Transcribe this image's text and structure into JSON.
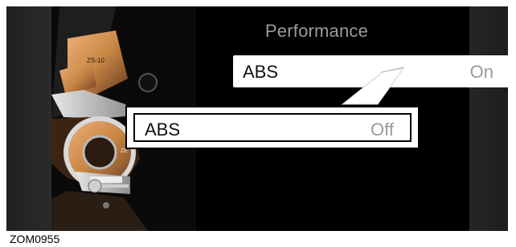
{
  "screen": {
    "title": "Performance",
    "current_row": {
      "label": "ABS",
      "value": "On"
    },
    "callout_row": {
      "label": "ABS",
      "value": "Off"
    }
  },
  "figure": {
    "code": "ZOM0955"
  },
  "illustration": {
    "subject": "motorcycle-engine",
    "colors": {
      "background": "#000000",
      "accent": "#c88a52",
      "metal": "#9b9b9b"
    },
    "marks": [
      "ZS-10"
    ]
  }
}
